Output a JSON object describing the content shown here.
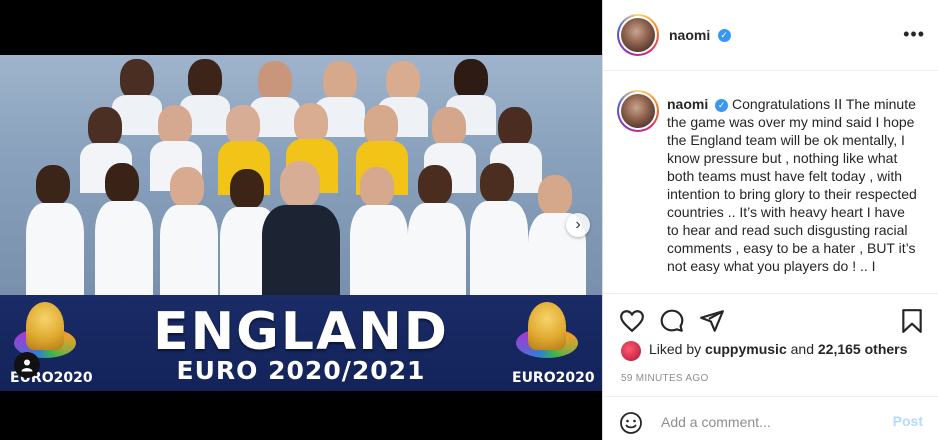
{
  "post": {
    "username": "naomi",
    "verified_icon": "verified-badge-icon",
    "more_icon": "more-options-icon",
    "more_label": "•••"
  },
  "media": {
    "banner_title": "ENGLAND",
    "banner_subtitle": "EURO 2020/2021",
    "logo_text_left": "EURO2020",
    "logo_text_right": "EURO2020",
    "next_icon": "chevron-right-icon",
    "next_label": "›",
    "tag_icon": "user-tag-icon"
  },
  "caption": {
    "username": "naomi",
    "text": "Congratulations ⅠⅠ The minute the game was over my mind said I hope the England team will be ok mentally, I know pressure but , nothing like what both teams must have felt today , with intention to bring glory to their respected countries .. It’s with heavy heart I have to hear and read such disgusting racial comments , easy to be a hater , BUT it’s not easy what you players do ! .. I"
  },
  "actions": {
    "like_icon": "heart-icon",
    "comment_icon": "comment-icon",
    "share_icon": "share-icon",
    "save_icon": "bookmark-icon"
  },
  "likes": {
    "prefix": "Liked by",
    "user": "cuppymusic",
    "middle": "and",
    "count": "22,165 others"
  },
  "timestamp": "59 MINUTES AGO",
  "comment": {
    "emoji_icon": "emoji-icon",
    "placeholder": "Add a comment...",
    "post_label": "Post"
  },
  "colors": {
    "accent_blue": "#3897f0",
    "post_disabled": "#b3dbff",
    "banner_navy": "#13235a"
  }
}
